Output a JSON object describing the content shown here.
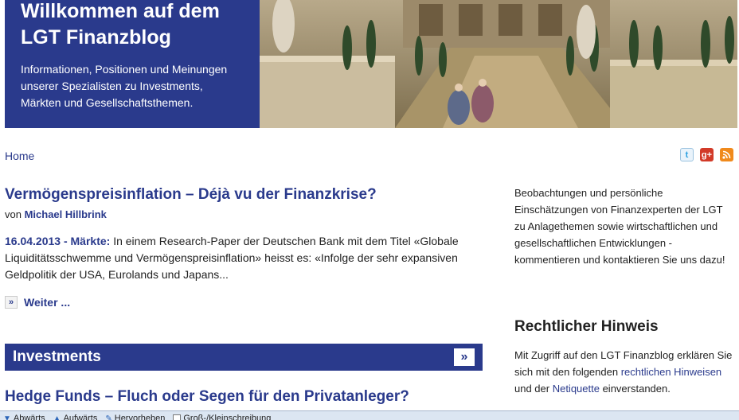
{
  "banner": {
    "title": "Willkommen auf dem LGT Finanzblog",
    "subtitle": "Informationen, Positionen und Meinungen unserer Spezialisten zu Investments, Märkten und Gesellschaftsthemen."
  },
  "breadcrumb": {
    "home": "Home"
  },
  "social": {
    "twitter": "t",
    "googleplus": "g+",
    "rss": "rss"
  },
  "article": {
    "title": "Vermögenspreisinflation – Déjà vu der Finanzkrise?",
    "by_prefix": "von",
    "author": "Michael Hillbrink",
    "meta": "16.04.2013 - Märkte:",
    "teaser": " In einem Research-Paper der Deutschen Bank mit dem Titel «Globale Liquiditätsschwemme und Vermögenspreisinflation» heisst es: «Infolge der sehr expansiven Geldpolitik der USA, Eurolands und Japans...",
    "more_label": "Weiter ...",
    "more_icon": "»"
  },
  "section": {
    "title": "Investments",
    "button": "»"
  },
  "article2": {
    "title": "Hedge Funds – Fluch oder Segen für den Privatanleger?"
  },
  "sidebar": {
    "intro": "Beobachtungen und persönliche Einschätzungen von Finanzexperten der LGT zu Anlagethemen sowie wirtschaftlichen und gesellschaftlichen Entwicklungen - kommentieren und kontaktieren Sie uns dazu!",
    "heading": "Rechtlicher Hinweis",
    "text_a": "Mit Zugriff auf den LGT Finanzblog erklären Sie sich mit den folgenden ",
    "link_legal": "rechtlichen Hinweisen",
    "text_b": " und der ",
    "link_netiquette": "Netiquette",
    "text_c": " einverstanden."
  },
  "statusbar": {
    "down": "Abwärts",
    "up": "Aufwärts",
    "highlight": "Hervorheben",
    "case": "Groß-/Kleinschreibung"
  },
  "colors": {
    "brand": "#2a3a8c",
    "statusbar": "#dce6f2"
  }
}
